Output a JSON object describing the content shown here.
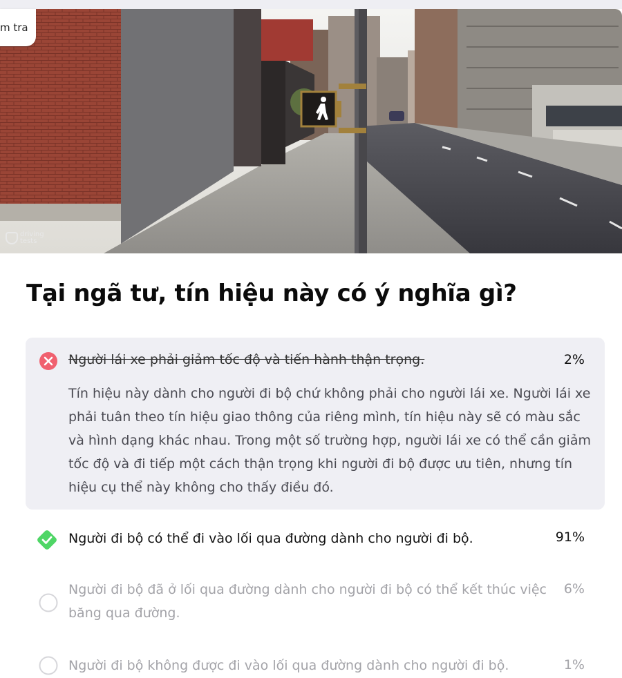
{
  "header": {
    "tag_label": "m tra"
  },
  "scene": {
    "watermark": "driving tests"
  },
  "question": {
    "title": "Tại ngã tư, tín hiệu này có ý nghĩa gì?"
  },
  "answers": [
    {
      "text": "Người lái xe phải giảm tốc độ và tiến hành thận trọng.",
      "percent": "2%",
      "state": "wrong",
      "explanation": "Tín hiệu này dành cho người đi bộ chứ không phải cho người lái xe. Người lái xe phải tuân theo tín hiệu giao thông của riêng mình, tín hiệu này sẽ có màu sắc và hình dạng khác nhau. Trong một số trường hợp, người lái xe có thể cần giảm tốc độ và đi tiếp một cách thận trọng khi người đi bộ được ưu tiên, nhưng tín hiệu cụ thể này không cho thấy điều đó."
    },
    {
      "text": "Người đi bộ có thể đi vào lối qua đường dành cho người đi bộ.",
      "percent": "91%",
      "state": "correct"
    },
    {
      "text": "Người đi bộ đã ở lối qua đường dành cho người đi bộ có thể kết thúc việc băng qua đường.",
      "percent": "6%",
      "state": "unselected"
    },
    {
      "text": "Người đi bộ không được đi vào lối qua đường dành cho người đi bộ.",
      "percent": "1%",
      "state": "unselected"
    }
  ],
  "colors": {
    "wrong": "#f0606f",
    "correct": "#4fd666",
    "muted": "#a3a3a8",
    "panel": "#efeff4"
  }
}
